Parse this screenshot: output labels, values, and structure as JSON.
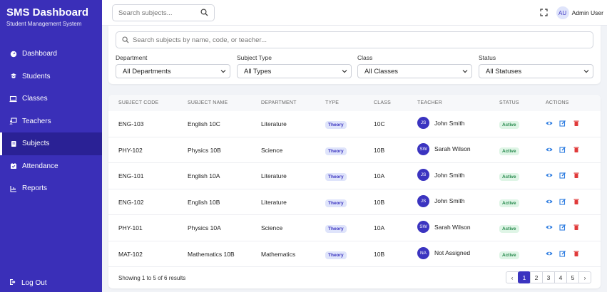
{
  "brand": {
    "title": "SMS Dashboard",
    "subtitle": "Student Management System"
  },
  "nav": [
    {
      "label": "Dashboard",
      "icon": "dashboard-icon"
    },
    {
      "label": "Students",
      "icon": "students-icon"
    },
    {
      "label": "Classes",
      "icon": "classes-icon"
    },
    {
      "label": "Teachers",
      "icon": "teachers-icon"
    },
    {
      "label": "Subjects",
      "icon": "subjects-icon",
      "active": true
    },
    {
      "label": "Attendance",
      "icon": "attendance-icon"
    },
    {
      "label": "Reports",
      "icon": "reports-icon"
    }
  ],
  "logout_label": "Log Out",
  "topbar": {
    "search_placeholder": "Search subjects...",
    "user_initials": "AU",
    "user_name": "Admin User"
  },
  "filters": {
    "search_placeholder": "Search subjects by name, code, or teacher...",
    "department": {
      "label": "Department",
      "value": "All Departments"
    },
    "type": {
      "label": "Subject Type",
      "value": "All Types"
    },
    "class": {
      "label": "Class",
      "value": "All Classes"
    },
    "status": {
      "label": "Status",
      "value": "All Statuses"
    }
  },
  "table": {
    "headers": [
      "SUBJECT CODE",
      "SUBJECT NAME",
      "DEPARTMENT",
      "TYPE",
      "CLASS",
      "TEACHER",
      "STATUS",
      "ACTIONS"
    ],
    "rows": [
      {
        "code": "ENG-103",
        "name": "English 10C",
        "department": "Literature",
        "type": "Theory",
        "class": "10C",
        "teacher_initials": "JS",
        "teacher": "John Smith",
        "status": "Active"
      },
      {
        "code": "PHY-102",
        "name": "Physics 10B",
        "department": "Science",
        "type": "Theory",
        "class": "10B",
        "teacher_initials": "SW",
        "teacher": "Sarah Wilson",
        "status": "Active"
      },
      {
        "code": "ENG-101",
        "name": "English 10A",
        "department": "Literature",
        "type": "Theory",
        "class": "10A",
        "teacher_initials": "JS",
        "teacher": "John Smith",
        "status": "Active"
      },
      {
        "code": "ENG-102",
        "name": "English 10B",
        "department": "Literature",
        "type": "Theory",
        "class": "10B",
        "teacher_initials": "JS",
        "teacher": "John Smith",
        "status": "Active"
      },
      {
        "code": "PHY-101",
        "name": "Physics 10A",
        "department": "Science",
        "type": "Theory",
        "class": "10A",
        "teacher_initials": "SW",
        "teacher": "Sarah Wilson",
        "status": "Active"
      },
      {
        "code": "MAT-102",
        "name": "Mathematics 10B",
        "department": "Mathematics",
        "type": "Theory",
        "class": "10B",
        "teacher_initials": "NA",
        "teacher": "Not Assigned",
        "status": "Active"
      }
    ]
  },
  "footer": {
    "showing_text": "Showing 1 to 5 of 6 results",
    "prev": "‹",
    "next": "›",
    "pages": [
      "1",
      "2",
      "3",
      "4",
      "5"
    ],
    "current_page": "1"
  },
  "colors": {
    "sidebar": "#3a2fb8",
    "accent": "#3b34c0",
    "active_green": "#23874a",
    "delete_red": "#e03a3a"
  }
}
